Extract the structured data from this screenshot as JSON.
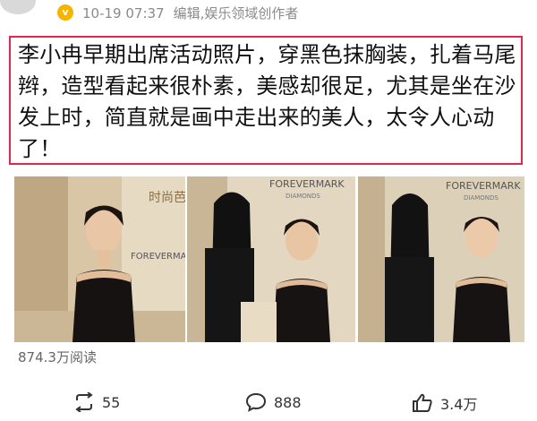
{
  "post": {
    "timestamp": "10-19 07:37",
    "meta": "编辑,娱乐领域创作者",
    "badge": "v",
    "text": "李小冉早期出席活动照片，穿黑色抹胸装，扎着马尾辫，造型看起来很朴素，美感却很足，尤其是坐在沙发上时，简直就是画中走出来的美人，太令人心动了！",
    "reads": "874.3万阅读"
  },
  "photos": [
    {
      "sign_top": "时尚芭莎",
      "sign_sub": "FOREVERMARK"
    },
    {
      "sign_top": "FOREVERMARK",
      "sign_sub": "DIAMONDS"
    },
    {
      "sign_top": "FOREVERMARK",
      "sign_sub": "DIAMONDS"
    }
  ],
  "actions": {
    "repost_count": "55",
    "comment_count": "888",
    "like_count": "3.4万"
  },
  "colors": {
    "highlight_border": "#e2264d",
    "badge": "#f6b300",
    "meta_text": "#8a8a8a"
  },
  "icons": [
    "repost-icon",
    "comment-icon",
    "like-icon",
    "verified-badge-icon"
  ]
}
